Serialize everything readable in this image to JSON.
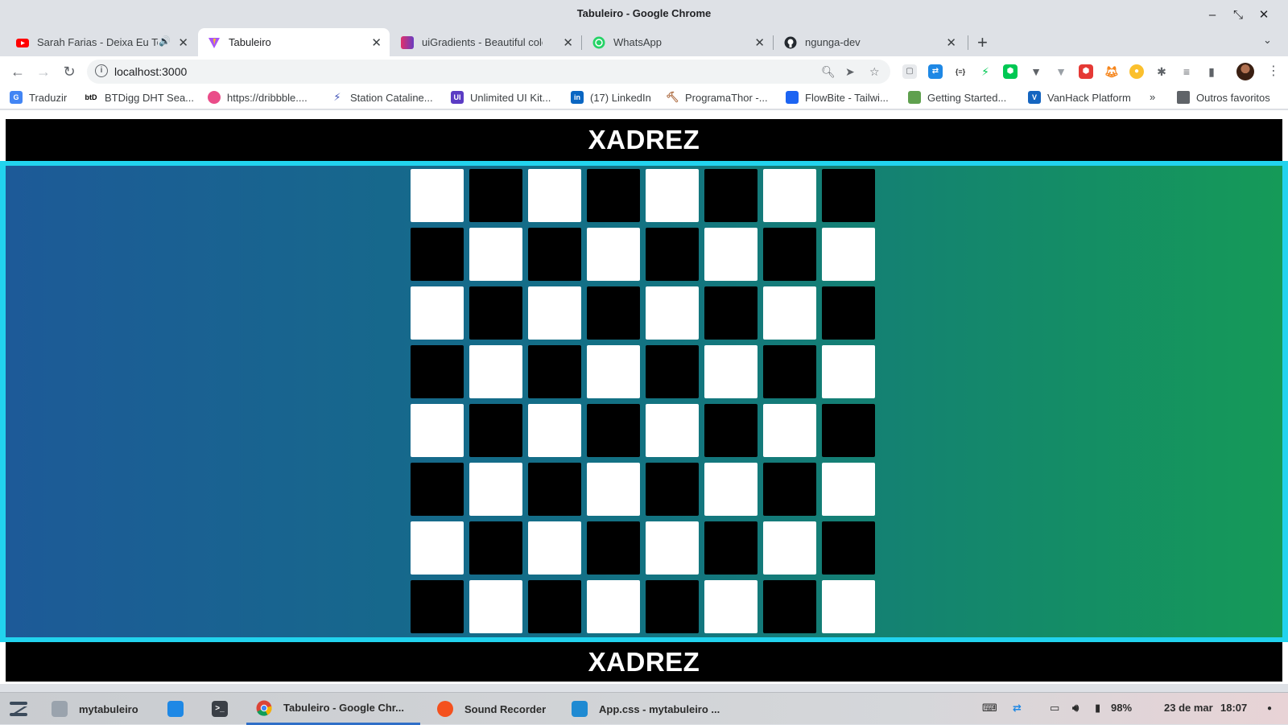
{
  "window": {
    "title": "Tabuleiro - Google Chrome"
  },
  "tabs": [
    {
      "label": "Sarah Farias - Deixa Eu Te",
      "icon": "youtube-icon",
      "audio": true
    },
    {
      "label": "Tabuleiro",
      "icon": "vite-icon",
      "active": true
    },
    {
      "label": "uiGradients - Beautiful colo",
      "icon": "uigradients-icon"
    },
    {
      "label": "WhatsApp",
      "icon": "whatsapp-icon"
    },
    {
      "label": "ngunga-dev",
      "icon": "github-icon"
    }
  ],
  "toolbar": {
    "url": "localhost:3000"
  },
  "bookmarks": [
    {
      "label": "Traduzir",
      "icon": "google-translate-icon"
    },
    {
      "label": "BTDigg DHT Sea...",
      "icon": "btdigg-icon"
    },
    {
      "label": "https://dribbble....",
      "icon": "dribbble-icon"
    },
    {
      "label": "Station Cataline...",
      "icon": "station-icon"
    },
    {
      "label": "Unlimited UI Kit...",
      "icon": "ui-kit-icon"
    },
    {
      "label": "(17) LinkedIn",
      "icon": "linkedin-icon"
    },
    {
      "label": "ProgramaThor -...",
      "icon": "programathor-icon"
    },
    {
      "label": "FlowBite - Tailwi...",
      "icon": "flowbite-icon"
    },
    {
      "label": "Getting Started...",
      "icon": "node-icon"
    },
    {
      "label": "VanHack Platform",
      "icon": "vanhack-icon"
    }
  ],
  "bookmarks_more": "»",
  "other_bookmarks": "Outros favoritos",
  "page": {
    "header_title": "XADREZ",
    "footer_title": "XADREZ",
    "board_size": 8,
    "colors": {
      "light": "#ffffff",
      "dark": "#000000",
      "frame": "#22d3ee",
      "gradient_start": "#1d5a98",
      "gradient_end": "#159a58"
    }
  },
  "taskbar": {
    "items": [
      {
        "label": "mytabuleiro",
        "icon": "folder-icon"
      },
      {
        "label": "",
        "icon": "store-icon"
      },
      {
        "label": "",
        "icon": "terminal-icon"
      },
      {
        "label": "Tabuleiro - Google Chr...",
        "icon": "chrome-icon",
        "active": true
      },
      {
        "label": "Sound Recorder",
        "icon": "microphone-icon"
      },
      {
        "label": "App.css - mytabuleiro ...",
        "icon": "vscode-icon"
      }
    ],
    "battery": "98%",
    "date": "23 de mar",
    "time": "18:07"
  }
}
